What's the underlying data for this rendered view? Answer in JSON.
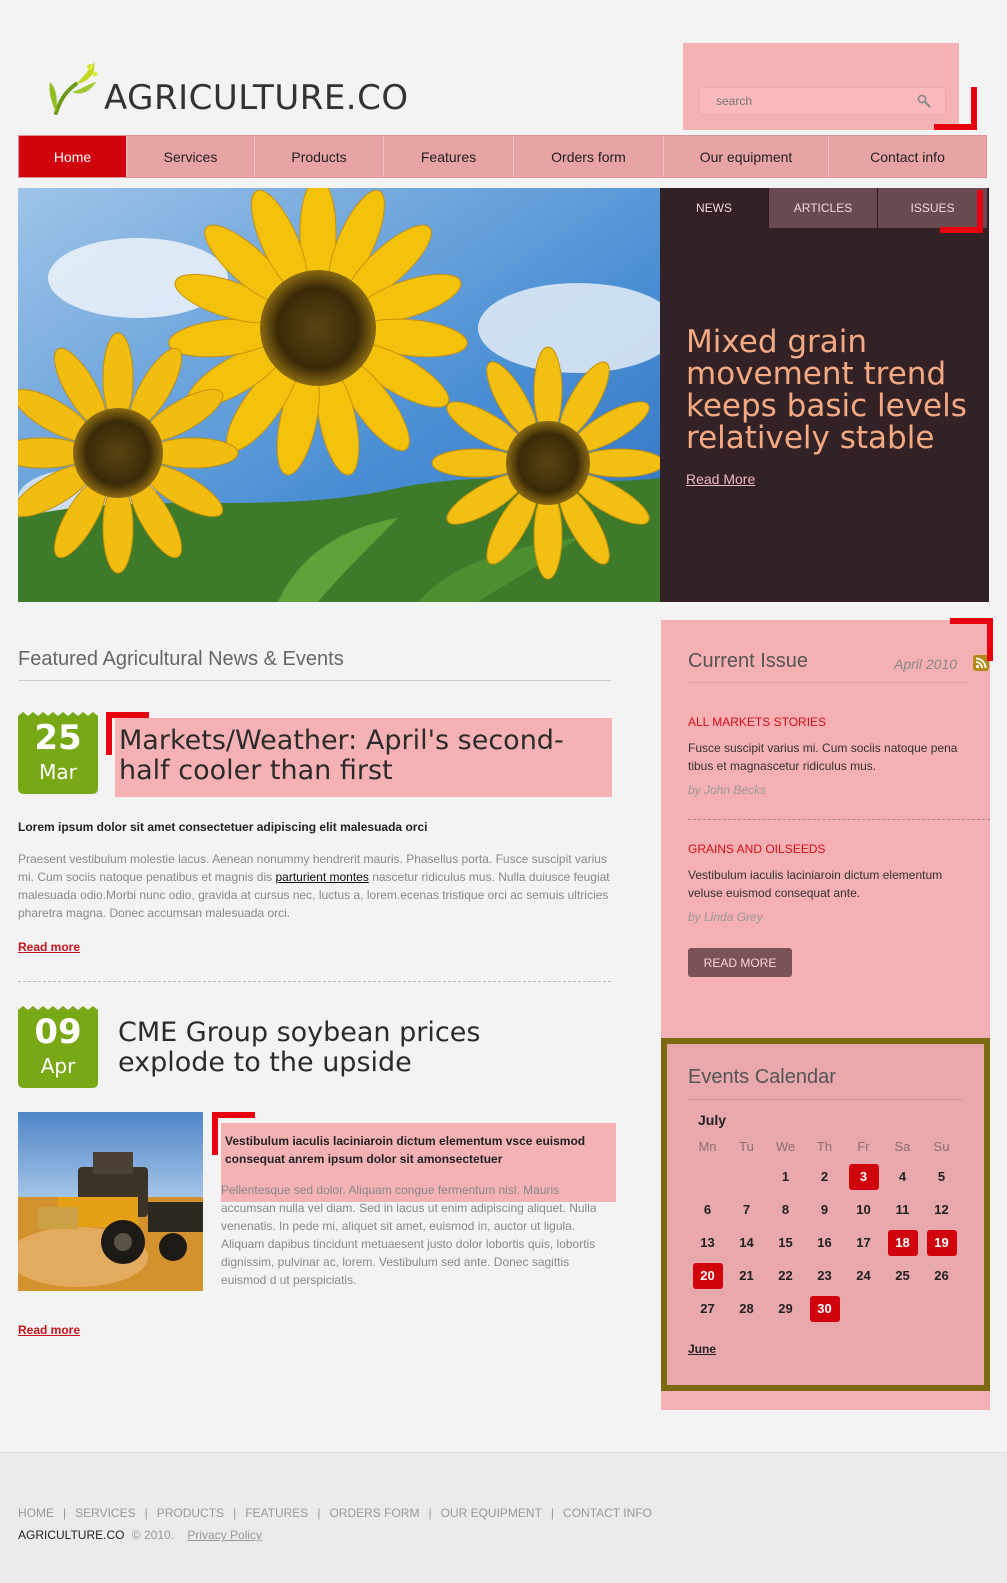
{
  "header": {
    "logo_text": "AGRICULTURE.CO",
    "search": {
      "placeholder": "search"
    }
  },
  "nav": {
    "items": [
      {
        "label": "Home",
        "active": true
      },
      {
        "label": "Services"
      },
      {
        "label": "Products"
      },
      {
        "label": "Features"
      },
      {
        "label": "Orders form"
      },
      {
        "label": "Our equipment"
      },
      {
        "label": "Contact info"
      }
    ]
  },
  "hero": {
    "tabs": [
      "NEWS",
      "ARTICLES",
      "ISSUES"
    ],
    "headline": "Mixed grain movement trend keeps basic levels relatively stable",
    "read_more": "Read More"
  },
  "featured": {
    "title": "Featured Agricultural News & Events",
    "articles": [
      {
        "day": "25",
        "month": "Mar",
        "title": "Markets/Weather: April's second-half cooler than first",
        "lead": "Lorem ipsum dolor sit amet consectetuer adipiscing elit malesuada orci",
        "body_before": "Praesent vestibulum molestie lacus. Aenean nonummy hendrerit mauris. Phasellus porta. Fusce suscipit varius mi. Cum sociis natoque penatibus et magnis dis ",
        "body_link": "parturient montes",
        "body_after": " nascetur ridiculus mus. Nulla duiusce feugiat malesuada odio.Morbi nunc odio, gravida at cursus nec, luctus a, lorem.ecenas tristique orci ac semuis ultricies pharetra magna. Donec accumsan malesuada orci.",
        "read_more": "Read more"
      },
      {
        "day": "09",
        "month": "Apr",
        "title": "CME Group soybean prices explode to the upside",
        "lead": "Vestibulum iaculis laciniaroin dictum elementum vsce euismod consequat anrem ipsum dolor sit amonsectetuer",
        "body": "Pellentesque sed dolor. Aliquam congue fermentum nisl. Mauris accumsan nulla vel diam. Sed in lacus ut enim adipiscing aliquet. Nulla venenatis. In pede mi, aliquet sit amet, euismod in, auctor ut ligula. Aliquam dapibus tincidunt metuaesent justo dolor lobortis quis, lobortis dignissim, pulvinar ac, lorem. Vestibulum sed ante. Donec sagittis euismod d ut perspiciatis.",
        "read_more": "Read more"
      }
    ]
  },
  "current_issue": {
    "title": "Current Issue",
    "date": "April 2010",
    "stories": [
      {
        "category": "ALL MARKETS STORIES",
        "text": "Fusce suscipit varius mi. Cum sociis natoque pena tibus et magnascetur ridiculus mus.",
        "author": "by John Becks"
      },
      {
        "category": "GRAINS AND OILSEEDS",
        "text": "Vestibulum iaculis laciniaroin dictum elementum veluse euismod consequat ante.",
        "author": "by Linda Grey"
      }
    ],
    "button": "READ MORE"
  },
  "calendar": {
    "title": "Events Calendar",
    "month": "July",
    "weekdays": [
      "Mn",
      "Tu",
      "We",
      "Th",
      "Fr",
      "Sa",
      "Su"
    ],
    "weeks": [
      [
        "",
        "",
        "1",
        "2",
        "3",
        "4",
        "5"
      ],
      [
        "6",
        "7",
        "8",
        "9",
        "10",
        "11",
        "12"
      ],
      [
        "13",
        "14",
        "15",
        "16",
        "17",
        "18",
        "19"
      ],
      [
        "20",
        "21",
        "22",
        "23",
        "24",
        "25",
        "26"
      ],
      [
        "27",
        "28",
        "29",
        "30",
        "",
        "",
        ""
      ]
    ],
    "highlighted": [
      "3",
      "18",
      "19",
      "20",
      "30"
    ],
    "prev": "June"
  },
  "footer": {
    "links": [
      "HOME",
      "SERVICES",
      "PRODUCTS",
      "FEATURES",
      "ORDERS FORM",
      "OUR EQUIPMENT",
      "CONTACT INFO"
    ],
    "brand": "AGRICULTURE.CO",
    "copy": "© 2010.",
    "privacy": "Privacy Policy"
  },
  "colors": {
    "accent": "#d0020c",
    "brand_green": "#79a817",
    "panel_dark": "#322226",
    "pink": "#f5b2b5"
  }
}
